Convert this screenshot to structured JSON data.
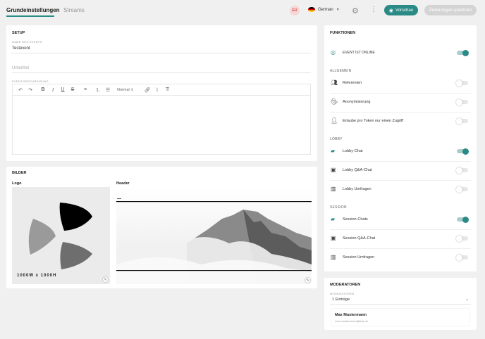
{
  "tabs": [
    {
      "label": "Grundeinstellungen",
      "active": true
    },
    {
      "label": "Streams",
      "active": false
    }
  ],
  "header": {
    "badge": "EU",
    "language": "German",
    "preview_label": "Vorschau",
    "save_label": "Änderungen speichern"
  },
  "setup": {
    "title": "SETUP",
    "event_name_label": "NAME DES EVENTS",
    "event_name_value": "Testevent",
    "subtitle_placeholder": "Untertitel",
    "description_label": "EVENT-BESCHREIBUNG",
    "format_select": "Normal"
  },
  "images": {
    "title": "BILDER",
    "logo_label": "Logo",
    "logo_size": "1000W x 1000H",
    "header_label": "Header"
  },
  "functions": {
    "title": "FUNKTIONEN",
    "online": {
      "label": "EVENT IST ONLINE",
      "on": true
    },
    "sections": [
      {
        "title": "ALLGEMEIN",
        "items": [
          {
            "label": "Referenten",
            "icon": "people-icon",
            "on": false
          },
          {
            "label": "Anonymisierung",
            "icon": "incognito-icon",
            "on": false
          },
          {
            "label": "Erlaube pro Token nur einen Zugriff",
            "icon": "user-key-icon",
            "on": false
          }
        ]
      },
      {
        "title": "LOBBY",
        "items": [
          {
            "label": "Lobby-Chat",
            "icon": "chat-icon",
            "on": true
          },
          {
            "label": "Lobby Q&A-Chat",
            "icon": "qa-chat-icon",
            "on": false
          },
          {
            "label": "Lobby Umfragen",
            "icon": "poll-icon",
            "on": false
          }
        ]
      },
      {
        "title": "SESSION",
        "items": [
          {
            "label": "Session-Chats",
            "icon": "chat-icon",
            "on": true
          },
          {
            "label": "Session Q&A-Chat",
            "icon": "qa-chat-icon",
            "on": false
          },
          {
            "label": "Session Umfragen",
            "icon": "poll-icon",
            "on": false
          }
        ]
      }
    ]
  },
  "moderators": {
    "title": "MODERATOREN",
    "field_label": "MODERATOREN",
    "select_value": "1 Einträge",
    "entries": [
      {
        "name": "Max Mustermann",
        "email": "max.mustermann@test.de"
      }
    ]
  },
  "colors": {
    "accent": "#2a8a85",
    "background": "#f0f0f0"
  }
}
